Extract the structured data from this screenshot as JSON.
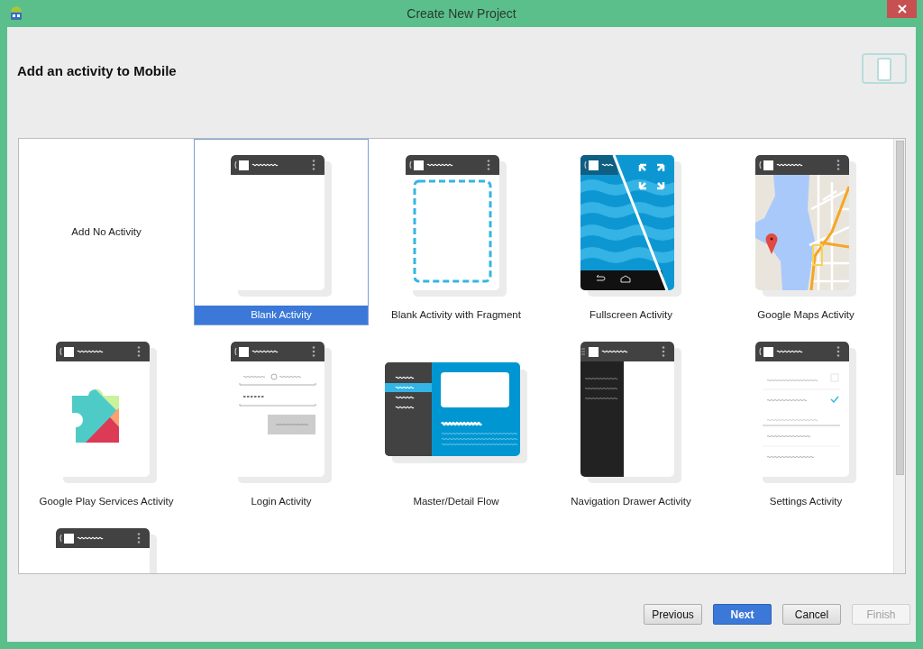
{
  "window": {
    "title": "Create New Project"
  },
  "header": {
    "title": "Add an activity to Mobile"
  },
  "templates": [
    {
      "kind": "none",
      "label": "Add No Activity",
      "selected": false
    },
    {
      "kind": "blank",
      "label": "Blank Activity",
      "selected": true
    },
    {
      "kind": "fragment",
      "label": "Blank Activity with Fragment",
      "selected": false
    },
    {
      "kind": "fullscreen",
      "label": "Fullscreen Activity",
      "selected": false
    },
    {
      "kind": "maps",
      "label": "Google Maps Activity",
      "selected": false
    },
    {
      "kind": "playservices",
      "label": "Google Play Services Activity",
      "selected": false
    },
    {
      "kind": "login",
      "label": "Login Activity",
      "selected": false
    },
    {
      "kind": "masterdetail",
      "label": "Master/Detail Flow",
      "selected": false
    },
    {
      "kind": "navdrawer",
      "label": "Navigation Drawer Activity",
      "selected": false
    },
    {
      "kind": "settings",
      "label": "Settings Activity",
      "selected": false
    },
    {
      "kind": "blank",
      "selected": false
    }
  ],
  "buttons": [
    {
      "label": "Previous",
      "kind": "secondary",
      "disabled": false
    },
    {
      "label": "Next",
      "kind": "primary",
      "disabled": false
    },
    {
      "label": "Cancel",
      "kind": "secondary",
      "disabled": false
    },
    {
      "label": "Finish",
      "kind": "secondary",
      "disabled": true
    }
  ]
}
